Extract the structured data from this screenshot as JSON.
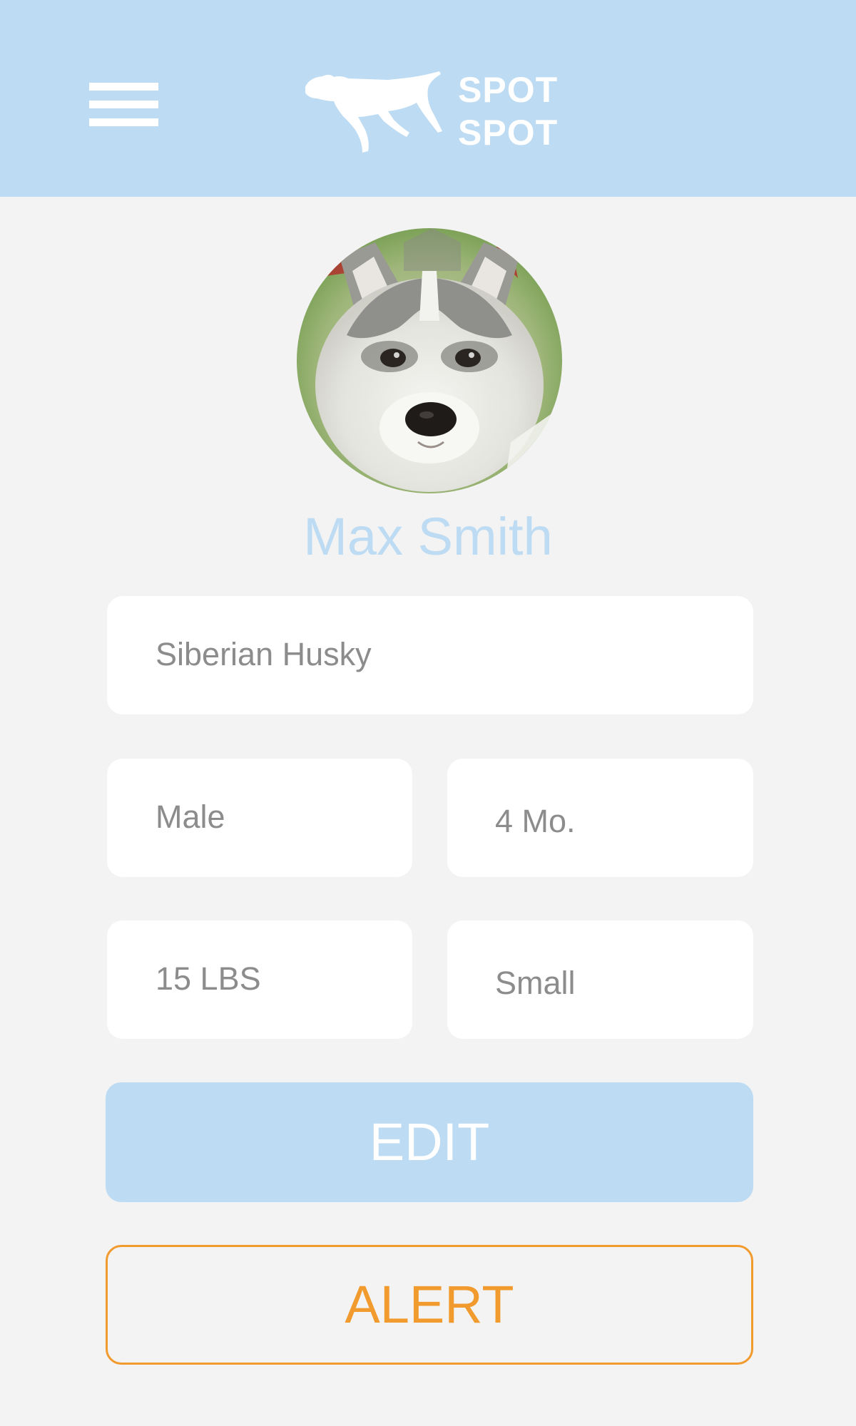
{
  "header": {
    "menu_icon": "hamburger-menu-icon",
    "logo_icon": "running-dog-logo-icon",
    "logo_line1": "SPOT",
    "logo_line2": "SPOT"
  },
  "profile": {
    "avatar_description": "husky-puppy-photo",
    "name": "Max Smith",
    "breed": "Siberian Husky",
    "sex": "Male",
    "age": "4 Mo.",
    "weight": "15 LBS",
    "size": "Small"
  },
  "actions": {
    "edit_label": "EDIT",
    "alert_label": "ALERT"
  },
  "colors": {
    "header_bg": "#bddbf2",
    "page_bg": "#f3f3f3",
    "accent_blue": "#bddbf2",
    "alert_orange": "#f19a2e",
    "field_text": "#8c8c8c"
  }
}
